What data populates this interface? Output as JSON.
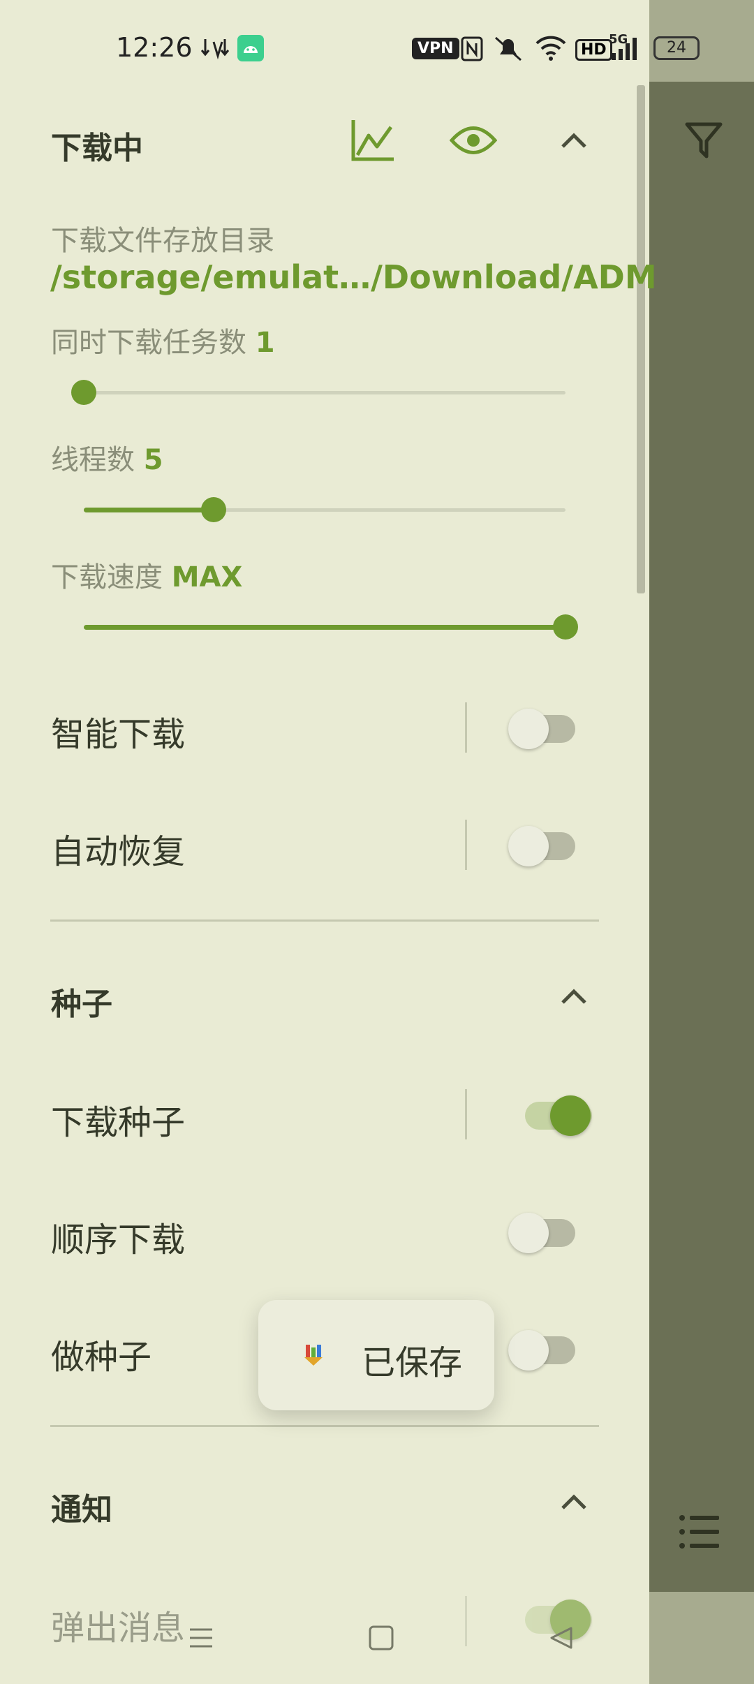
{
  "status_bar": {
    "time": "12:26",
    "vpn_label": "VPN",
    "hd_label": "HD",
    "network_label": "5G",
    "battery": "24"
  },
  "downloading": {
    "title": "下载中",
    "dir_label": "下载文件存放目录",
    "dir_path": "/storage/emulat…/Download/ADM",
    "concurrent_label": "同时下载任务数",
    "concurrent_value": "1",
    "threads_label": "线程数",
    "threads_value": "5",
    "speed_label": "下载速度",
    "speed_value": "MAX",
    "smart_download_label": "智能下载",
    "auto_resume_label": "自动恢复",
    "sliders": {
      "concurrent_fraction": 0.0,
      "threads_fraction": 0.27,
      "speed_fraction": 1.0
    }
  },
  "torrent": {
    "title": "种子",
    "download_torrent_label": "下载种子",
    "sequential_label": "顺序下载",
    "seeding_label": "做种子"
  },
  "notifications": {
    "title": "通知",
    "popup_label": "弹出消息"
  },
  "toast": {
    "message": "已保存"
  },
  "switches": {
    "smart_download": false,
    "auto_resume": false,
    "download_torrent": true,
    "sequential": false,
    "seeding": false,
    "popup": true
  },
  "colors": {
    "accent": "#6e9a2e",
    "background": "#e9ebd4",
    "overlay": "#6b7055"
  }
}
